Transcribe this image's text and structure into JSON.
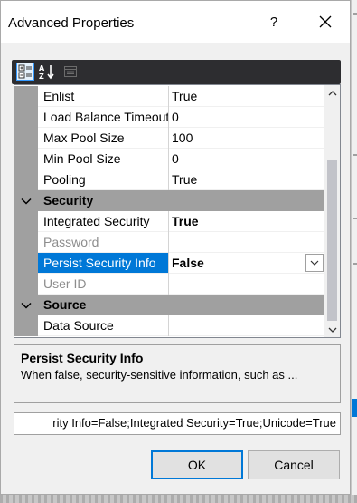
{
  "dialog": {
    "title": "Advanced Properties",
    "help_label": "?"
  },
  "toolbar": {
    "buttons": [
      {
        "icon": "categorized-icon"
      },
      {
        "icon": "alphabetical-icon"
      },
      {
        "icon": "property-pages-icon"
      }
    ]
  },
  "grid": {
    "rows": [
      {
        "name": "Enlist",
        "value": "True"
      },
      {
        "name": "Load Balance Timeout",
        "value": "0"
      },
      {
        "name": "Max Pool Size",
        "value": "100"
      },
      {
        "name": "Min Pool Size",
        "value": "0"
      },
      {
        "name": "Pooling",
        "value": "True"
      }
    ],
    "security": {
      "category": "Security",
      "rows": [
        {
          "name": "Integrated Security",
          "value": "True"
        },
        {
          "name": "Password",
          "value": ""
        },
        {
          "name": "Persist Security Info",
          "value": "False"
        },
        {
          "name": "User ID",
          "value": ""
        }
      ]
    },
    "source": {
      "category": "Source",
      "rows": [
        {
          "name": "Data Source",
          "value": ""
        }
      ]
    }
  },
  "description": {
    "title": "Persist Security Info",
    "text": "When false, security-sensitive information, such as ..."
  },
  "connection_string": "rity Info=False;Integrated Security=True;Unicode=True",
  "buttons": {
    "ok": "OK",
    "cancel": "Cancel"
  },
  "colors": {
    "selection": "#0078d7",
    "category_bg": "#a0a0a0",
    "toolbar_bg": "#2d2d30"
  }
}
